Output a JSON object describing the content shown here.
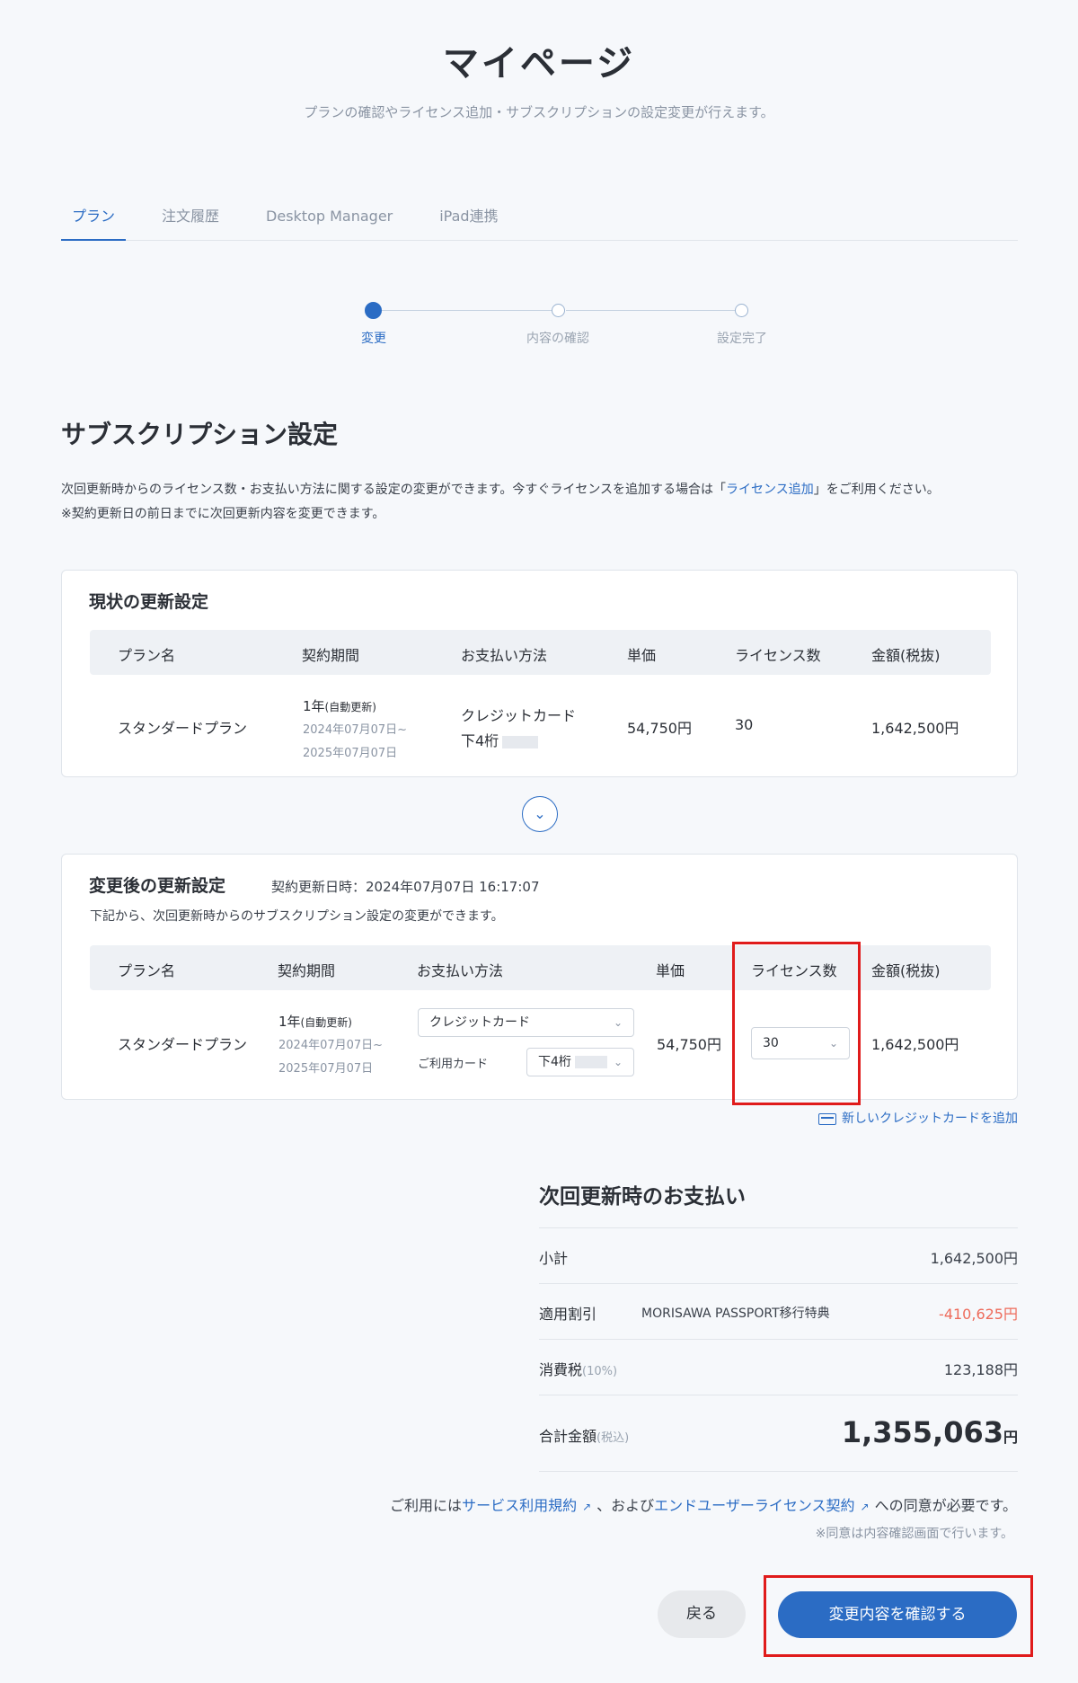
{
  "header": {
    "title": "マイページ",
    "subtitle": "プランの確認やライセンス追加・サブスクリプションの設定変更が行えます。"
  },
  "tabs": [
    {
      "label": "プラン",
      "active": true
    },
    {
      "label": "注文履歴",
      "active": false
    },
    {
      "label": "Desktop Manager",
      "active": false
    },
    {
      "label": "iPad連携",
      "active": false
    }
  ],
  "stepper": {
    "steps": [
      "変更",
      "内容の確認",
      "設定完了"
    ],
    "current": 0
  },
  "section": {
    "title": "サブスクリプション設定",
    "desc_line1_pre": "次回更新時からのライセンス数・お支払い方法に関する設定の変更ができます。今すぐライセンスを追加する場合は「",
    "desc_link": "ライセンス追加",
    "desc_line1_post": "」をご利用ください。",
    "desc_line2": "※契約更新日の前日までに次回更新内容を変更できます。"
  },
  "current": {
    "title": "現状の更新設定",
    "headers": [
      "プラン名",
      "契約期間",
      "お支払い方法",
      "単価",
      "ライセンス数",
      "金額(税抜)"
    ],
    "plan": "スタンダードプラン",
    "period_main": "1年",
    "period_note": "(自動更新)",
    "period_from": "2024年07月07日~",
    "period_to": "2025年07月07日",
    "payment": "クレジットカード",
    "card_prefix": "下4桁",
    "unit_price": "54,750円",
    "licenses": "30",
    "amount": "1,642,500円"
  },
  "changed": {
    "title": "変更後の更新設定",
    "renewal": "契約更新日時：2024年07月07日 16:17:07",
    "note": "下記から、次回更新時からのサブスクリプション設定の変更ができます。",
    "headers": [
      "プラン名",
      "契約期間",
      "お支払い方法",
      "単価",
      "ライセンス数",
      "金額(税抜)"
    ],
    "plan": "スタンダードプラン",
    "period_main": "1年",
    "period_note": "(自動更新)",
    "period_from": "2024年07月07日~",
    "period_to": "2025年07月07日",
    "payment_select": "クレジットカード",
    "card_label": "ご利用カード",
    "card_select": "下4桁",
    "unit_price": "54,750円",
    "license_select": "30",
    "amount": "1,642,500円"
  },
  "add_card_label": "新しいクレジットカードを追加",
  "payment": {
    "title": "次回更新時のお支払い",
    "subtotal_label": "小計",
    "subtotal": "1,642,500円",
    "discount_label": "適用割引",
    "discount_note": "MORISAWA PASSPORT移行特典",
    "discount": "-410,625円",
    "tax_label": "消費税",
    "tax_note": "(10%)",
    "tax": "123,188円",
    "total_label": "合計金額",
    "total_note": "(税込)",
    "total_value": "1,355,063",
    "total_unit": "円"
  },
  "agreement": {
    "pre": "ご利用には",
    "link1": "サービス利用規約",
    "mid": "、および",
    "link2": "エンドユーザーライセンス契約",
    "post": "への同意が必要です。",
    "note": "※同意は内容確認画面で行います。"
  },
  "buttons": {
    "back": "戻る",
    "confirm": "変更内容を確認する"
  },
  "colors": {
    "accent": "#2b6cc4",
    "discount": "#ee6b5b",
    "highlight": "#e01b1b"
  }
}
